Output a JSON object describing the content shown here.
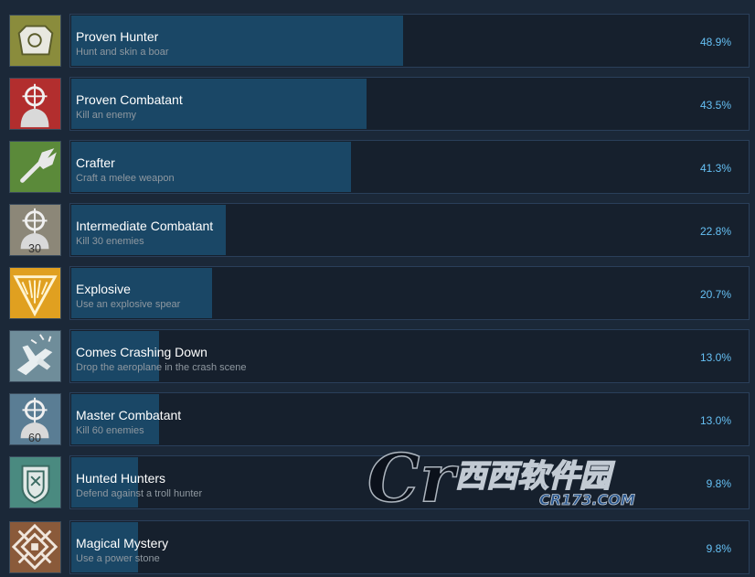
{
  "achievements": [
    {
      "name": "Proven Hunter",
      "description": "Hunt and skin a boar",
      "percent_label": "48.9%",
      "percent": 48.9,
      "icon": "boar-skin-icon",
      "icon_color": "#8a8c3c"
    },
    {
      "name": "Proven Combatant",
      "description": "Kill an enemy",
      "percent_label": "43.5%",
      "percent": 43.5,
      "icon": "crosshair-person-icon",
      "icon_color": "#b22e2e"
    },
    {
      "name": "Crafter",
      "description": "Craft a melee weapon",
      "percent_label": "41.3%",
      "percent": 41.3,
      "icon": "wrench-icon",
      "icon_color": "#5b8a3a"
    },
    {
      "name": "Intermediate Combatant",
      "description": "Kill 30 enemies",
      "percent_label": "22.8%",
      "percent": 22.8,
      "icon": "crosshair-person-icon",
      "icon_color": "#8c8778",
      "icon_text": "30"
    },
    {
      "name": "Explosive",
      "description": "Use an explosive spear",
      "percent_label": "20.7%",
      "percent": 20.7,
      "icon": "explosion-triangle-icon",
      "icon_color": "#e0a020"
    },
    {
      "name": "Comes Crashing Down",
      "description": "Drop the aeroplane in the crash scene",
      "percent_label": "13.0%",
      "percent": 13.0,
      "icon": "crashing-plane-icon",
      "icon_color": "#6f8d9a"
    },
    {
      "name": "Master Combatant",
      "description": "Kill 60 enemies",
      "percent_label": "13.0%",
      "percent": 13.0,
      "icon": "crosshair-person-icon",
      "icon_color": "#5a7d94",
      "icon_text": "60"
    },
    {
      "name": "Hunted Hunters",
      "description": "Defend against a troll hunter",
      "percent_label": "9.8%",
      "percent": 9.8,
      "icon": "shield-icon",
      "icon_color": "#4a8a80"
    },
    {
      "name": "Magical Mystery",
      "description": "Use a power stone",
      "percent_label": "9.8%",
      "percent": 9.8,
      "icon": "rune-stone-icon",
      "icon_color": "#8a5a3a"
    }
  ],
  "watermark": {
    "logo_text": "Cr",
    "brand_text": "西西软件园",
    "url_text": "CR173.COM"
  },
  "colors": {
    "bar": "#1a4766",
    "panel": "#16202d",
    "percent": "#66c0f4"
  }
}
